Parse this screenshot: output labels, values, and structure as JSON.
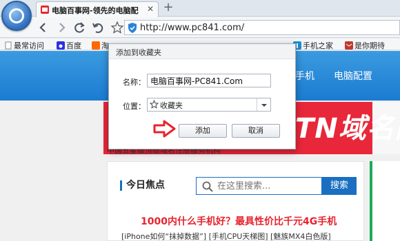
{
  "browser": {
    "tab_title": "电脑百事网-领先的电脑配",
    "tab_close": "✕",
    "new_tab": "+",
    "url": "http://www.pc841.com/"
  },
  "bookmarks": [
    {
      "label": "最常访问",
      "icon": "page-icon"
    },
    {
      "label": "百度",
      "icon": "baidu-paw-icon"
    },
    {
      "label": "淘",
      "icon": "taobao-icon"
    },
    {
      "label": "手机之家",
      "icon": "phone-home-icon"
    },
    {
      "label": "是你期待",
      "icon": "mail-icon"
    }
  ],
  "site_nav": {
    "items": [
      "手机",
      "电脑配置"
    ]
  },
  "banner": {
    "headline": "TN域名降",
    "sub": "中国五星级顶级域名注册服务机构"
  },
  "focus": {
    "title": "今日焦点",
    "search_placeholder": "在这里搜索...",
    "search_button": "搜索",
    "headline": "1000内什么手机好？最具性价比千元4G手机",
    "subline": "[iPhone如何“抹掉数据”] [手机CPU天梯图] [魅族MX4白色版]"
  },
  "dialog": {
    "title": "添加到收藏夹",
    "name_label": "名称：",
    "name_value": "电脑百事网-PC841.Com",
    "folder_label": "位置：",
    "folder_value": "收藏夹",
    "add_button": "添加",
    "cancel_button": "取消"
  },
  "colors": {
    "accent_blue": "#1a6fc1",
    "nav_blue": "#1b7bd1",
    "banner_red": "#e8273a",
    "headline_red": "#e8232d",
    "arrow_red": "#e8232d"
  }
}
